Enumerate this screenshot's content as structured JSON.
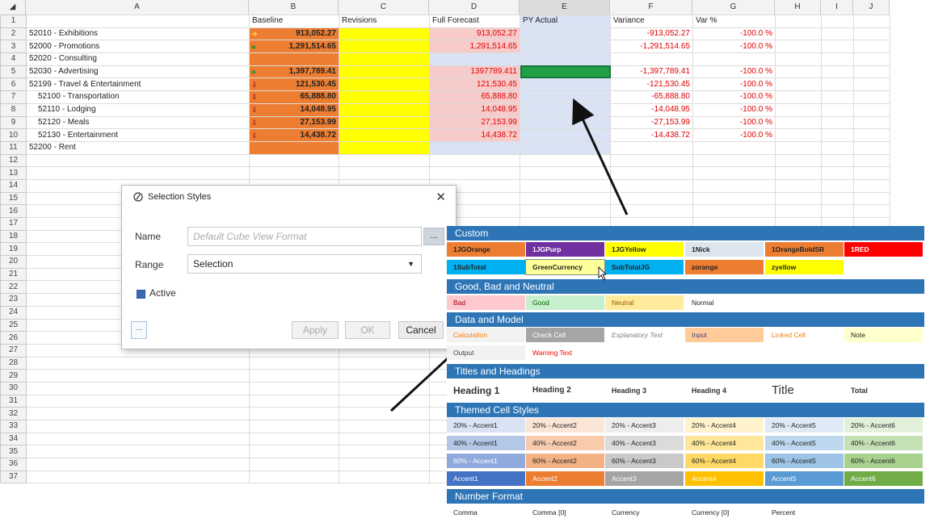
{
  "columns": [
    "A",
    "B",
    "C",
    "D",
    "E",
    "F",
    "G",
    "H",
    "I",
    "J"
  ],
  "row_numbers": [
    "1",
    "2",
    "3",
    "4",
    "5",
    "6",
    "7",
    "8",
    "9",
    "10",
    "11",
    "12",
    "13",
    "14",
    "15",
    "16",
    "17",
    "18",
    "19",
    "20",
    "21",
    "22",
    "23",
    "24",
    "25",
    "26",
    "27",
    "28",
    "29",
    "30",
    "31",
    "32",
    "33",
    "34",
    "35",
    "36",
    "37"
  ],
  "header_row": [
    "",
    "Baseline",
    "Revisions",
    "Full Forecast",
    "PY Actual",
    "Variance",
    "Var %"
  ],
  "rows": [
    {
      "account": "52010 - Exhibitions",
      "icon": "➔",
      "baseline": "913,052.27",
      "forecast": "913,052.27",
      "variance": "-913,052.27",
      "varpct": "-100.0 %"
    },
    {
      "account": "52000 - Promotions",
      "icon": "♣",
      "baseline": "1,291,514.65",
      "forecast": "1,291,514.65",
      "variance": "-1,291,514.65",
      "varpct": "-100.0 %"
    },
    {
      "account": "52020 - Consulting",
      "icon": "",
      "baseline": "",
      "forecast": "",
      "variance": "",
      "varpct": ""
    },
    {
      "account": "52030 - Advertising",
      "icon": "♣",
      "baseline": "1,397,789.41",
      "forecast": "1397789.411",
      "variance": "-1,397,789.41",
      "varpct": "-100.0 %"
    },
    {
      "account": "52199 - Travel & Entertainment",
      "icon": "⇓",
      "baseline": "121,530.45",
      "forecast": "121,530.45",
      "variance": "-121,530.45",
      "varpct": "-100.0 %"
    },
    {
      "account": "52100 - Transportation",
      "icon": "⇓",
      "baseline": "65,888.80",
      "forecast": "65,888.80",
      "variance": "-65,888.80",
      "varpct": "-100.0 %"
    },
    {
      "account": "52110 - Lodging",
      "icon": "⇓",
      "baseline": "14,048.95",
      "forecast": "14,048.95",
      "variance": "-14,048.95",
      "varpct": "-100.0 %"
    },
    {
      "account": "52120 - Meals",
      "icon": "⇓",
      "baseline": "27,153.99",
      "forecast": "27,153.99",
      "variance": "-27,153.99",
      "varpct": "-100.0 %"
    },
    {
      "account": "52130 - Entertainment",
      "icon": "⇓",
      "baseline": "14,438.72",
      "forecast": "14,438.72",
      "variance": "-14,438.72",
      "varpct": "-100.0 %"
    },
    {
      "account": "52200 - Rent",
      "icon": "",
      "baseline": "",
      "forecast": "",
      "variance": "",
      "varpct": ""
    }
  ],
  "dialog": {
    "title": "Selection Styles",
    "close": "✕",
    "name_label": "Name",
    "name_placeholder": "Default Cube View Format",
    "ellipsis": "...",
    "range_label": "Range",
    "range_value": "Selection",
    "active_label": "Active",
    "more_button": "...",
    "apply": "Apply",
    "ok": "OK",
    "cancel": "Cancel"
  },
  "gallery": {
    "sections": [
      "Custom",
      "Good, Bad and Neutral",
      "Data and Model",
      "Titles and Headings",
      "Themed Cell Styles",
      "Number Format"
    ],
    "custom_row1": [
      "1JGOrange",
      "1JGPurp",
      "1JGYellow",
      "1Nick",
      "1OrangeBoldSR",
      "1RED"
    ],
    "custom_row2": [
      "1SubTotal",
      "GreenCurrency",
      "SubTotalJG",
      "zorange",
      "zyellow"
    ],
    "gbn": [
      "Bad",
      "Good",
      "Neutral",
      "Normal"
    ],
    "dm_row1": [
      "Calculation",
      "Check Cell",
      "Explanatory Text",
      "Input",
      "Linked Cell",
      "Note"
    ],
    "dm_row2": [
      "Output",
      "Warning Text"
    ],
    "titles": [
      "Heading 1",
      "Heading 2",
      "Heading 3",
      "Heading 4",
      "Title",
      "Total"
    ],
    "accent20": [
      "20% - Accent1",
      "20% - Accent2",
      "20% - Accent3",
      "20% - Accent4",
      "20% - Accent5",
      "20% - Accent6"
    ],
    "accent40": [
      "40% - Accent1",
      "40% - Accent2",
      "40% - Accent3",
      "40% - Accent4",
      "40% - Accent5",
      "40% - Accent6"
    ],
    "accent60": [
      "60% - Accent1",
      "60% - Accent2",
      "60% - Accent3",
      "60% - Accent4",
      "60% - Accent5",
      "60% - Accent6"
    ],
    "accent": [
      "Accent1",
      "Accent2",
      "Accent3",
      "Accent4",
      "Accent5",
      "Accent6"
    ],
    "numfmt": [
      "Comma",
      "Comma [0]",
      "Currency",
      "Currency [0]",
      "Percent"
    ]
  },
  "colors": {
    "orange": "#ed7d31",
    "yellow": "#ffff00",
    "pink": "#f8cbcb",
    "lightblue": "#dae3f3",
    "green_selected": "#21a047",
    "header_blue": "#2e75b6"
  }
}
